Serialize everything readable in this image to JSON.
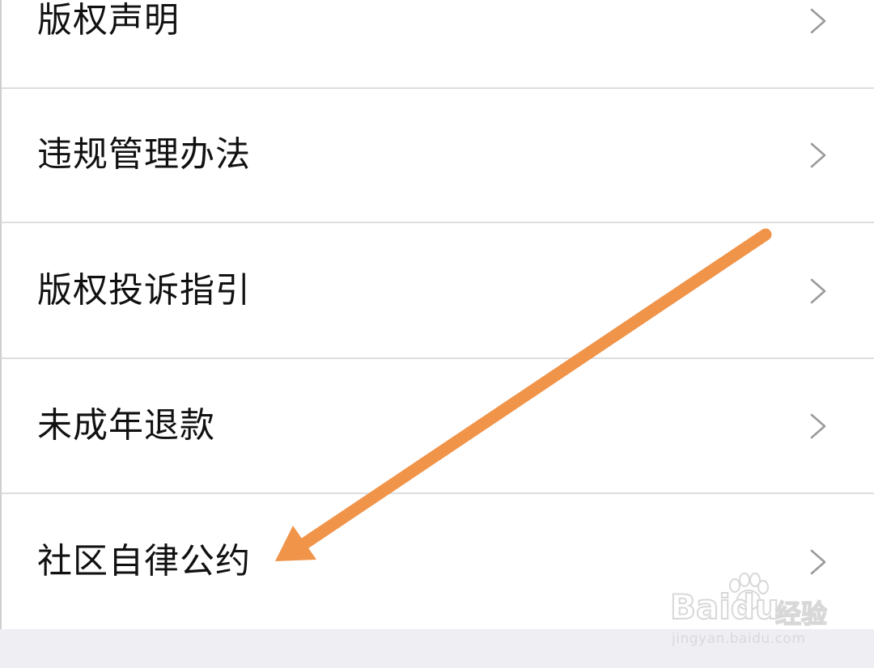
{
  "menu": {
    "items": [
      {
        "label": "版权声明"
      },
      {
        "label": "违规管理办法"
      },
      {
        "label": "版权投诉指引"
      },
      {
        "label": "未成年退款"
      },
      {
        "label": "社区自律公约"
      }
    ]
  },
  "annotation": {
    "arrow_color": "#F0944A",
    "points_to": "社区自律公约"
  },
  "watermark": {
    "brand": "Baidu",
    "product": "经验",
    "url": "jingyan.baidu.com"
  },
  "colors": {
    "background": "#FFFFFF",
    "divider": "#DEDEDE",
    "text": "#111111",
    "chevron": "#9A9A9A",
    "footer": "#EFEFF3"
  }
}
